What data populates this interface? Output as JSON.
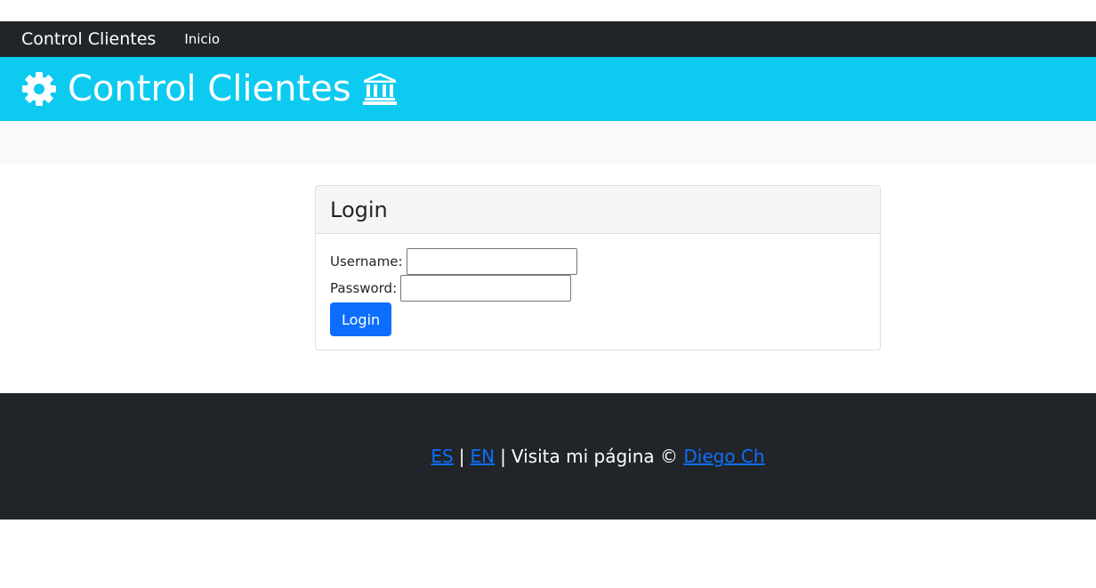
{
  "navbar": {
    "brand": "Control Clientes",
    "links": [
      {
        "label": "Inicio"
      }
    ]
  },
  "header": {
    "title": "Control Clientes",
    "left_icon": "gear-icon",
    "right_icon": "bank-icon"
  },
  "login_card": {
    "title": "Login",
    "username_label": "Username:",
    "username_value": "",
    "password_label": "Password:",
    "password_value": "",
    "submit_label": "Login"
  },
  "footer": {
    "lang_es": "ES",
    "separator": "|",
    "lang_en": "EN",
    "visit_text": "Visita mi página ©",
    "author_link": "Diego Ch"
  },
  "colors": {
    "navbar_bg": "#212529",
    "header_bg": "#0dcaf0",
    "primary": "#0d6efd",
    "subbar_bg": "#f8f9fa",
    "footer_bg": "#212529"
  }
}
